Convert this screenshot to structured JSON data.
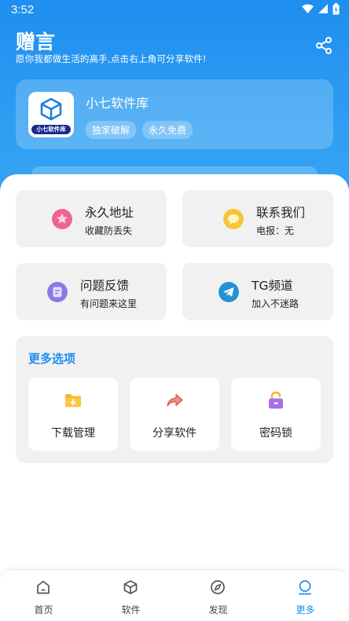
{
  "status_bar": {
    "time": "3:52"
  },
  "header": {
    "title": "赠言",
    "subtitle": "愿你我都做生活的高手,点击右上角可分享软件!",
    "share_icon": "share-icon"
  },
  "app": {
    "name": "小七软件库",
    "logo_text": "小七软件库",
    "tags": [
      "独家破解",
      "永久免费"
    ]
  },
  "quick_cards": [
    {
      "title": "永久地址",
      "subtitle": "收藏防丢失",
      "icon": "star-icon",
      "color": "#f06292"
    },
    {
      "title": "联系我们",
      "subtitle": "电报：无",
      "icon": "chat-bubble-icon",
      "color": "#f7c534"
    },
    {
      "title": "问题反馈",
      "subtitle": "有问题来这里",
      "icon": "feedback-icon",
      "color": "#8a79e6"
    },
    {
      "title": "TG频道",
      "subtitle": "加入不迷路",
      "icon": "telegram-icon",
      "color": "#2490d6"
    }
  ],
  "more": {
    "title": "更多选项",
    "items": [
      {
        "label": "下载管理",
        "icon": "download-folder-icon",
        "color": "#f7b733"
      },
      {
        "label": "分享软件",
        "icon": "share-arrow-icon",
        "color": "#f08a80"
      },
      {
        "label": "密码锁",
        "icon": "lock-icon",
        "color": "#a86ee8"
      }
    ]
  },
  "nav": {
    "items": [
      {
        "label": "首页",
        "icon": "home-icon"
      },
      {
        "label": "软件",
        "icon": "box-icon"
      },
      {
        "label": "发现",
        "icon": "compass-icon"
      },
      {
        "label": "更多",
        "icon": "user-icon"
      }
    ],
    "active": "更多",
    "accent": "#1e8ef0"
  }
}
